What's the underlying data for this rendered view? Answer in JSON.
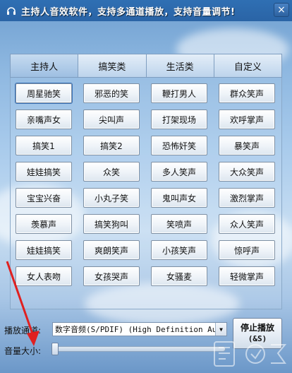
{
  "window": {
    "title": "主持人音效软件，支持多通道播放，支持音量调节!",
    "title_icon": "headphones-icon",
    "close_icon": "close-icon"
  },
  "tabs": [
    {
      "label": "主持人",
      "active": true
    },
    {
      "label": "搞笑类",
      "active": false
    },
    {
      "label": "生活类",
      "active": false
    },
    {
      "label": "自定义",
      "active": false
    }
  ],
  "sound_buttons": [
    "周星驰笑",
    "邪恶的笑",
    "鞭打男人",
    "群众笑声",
    "亲嘴声女",
    "尖叫声",
    "打架现场",
    "欢呼掌声",
    "搞笑1",
    "搞笑2",
    "恐怖奸笑",
    "暴笑声",
    "娃娃搞笑",
    "众笑",
    "多人笑声",
    "大众笑声",
    "宝宝兴奋",
    "小丸子笑",
    "鬼叫声女",
    "激烈掌声",
    "羡慕声",
    "搞笑狗叫",
    "笑喷声",
    "众人笑声",
    "娃娃搞笑",
    "爽朗笑声",
    "小孩笑声",
    "惊呼声",
    "女人表吻",
    "女孩哭声",
    "女骚麦",
    "轻微掌声"
  ],
  "controls": {
    "channel_label": "播放通道:",
    "channel_value": "数字音频(S/PDIF) (High Definition Audi",
    "stop_label": "停止播放",
    "stop_shortcut": "(&S)",
    "volume_label": "音量大小:",
    "volume_level": 0.0
  },
  "colors": {
    "title_bar": "#2f6fb3",
    "annotation_arrow": "#e02020"
  }
}
